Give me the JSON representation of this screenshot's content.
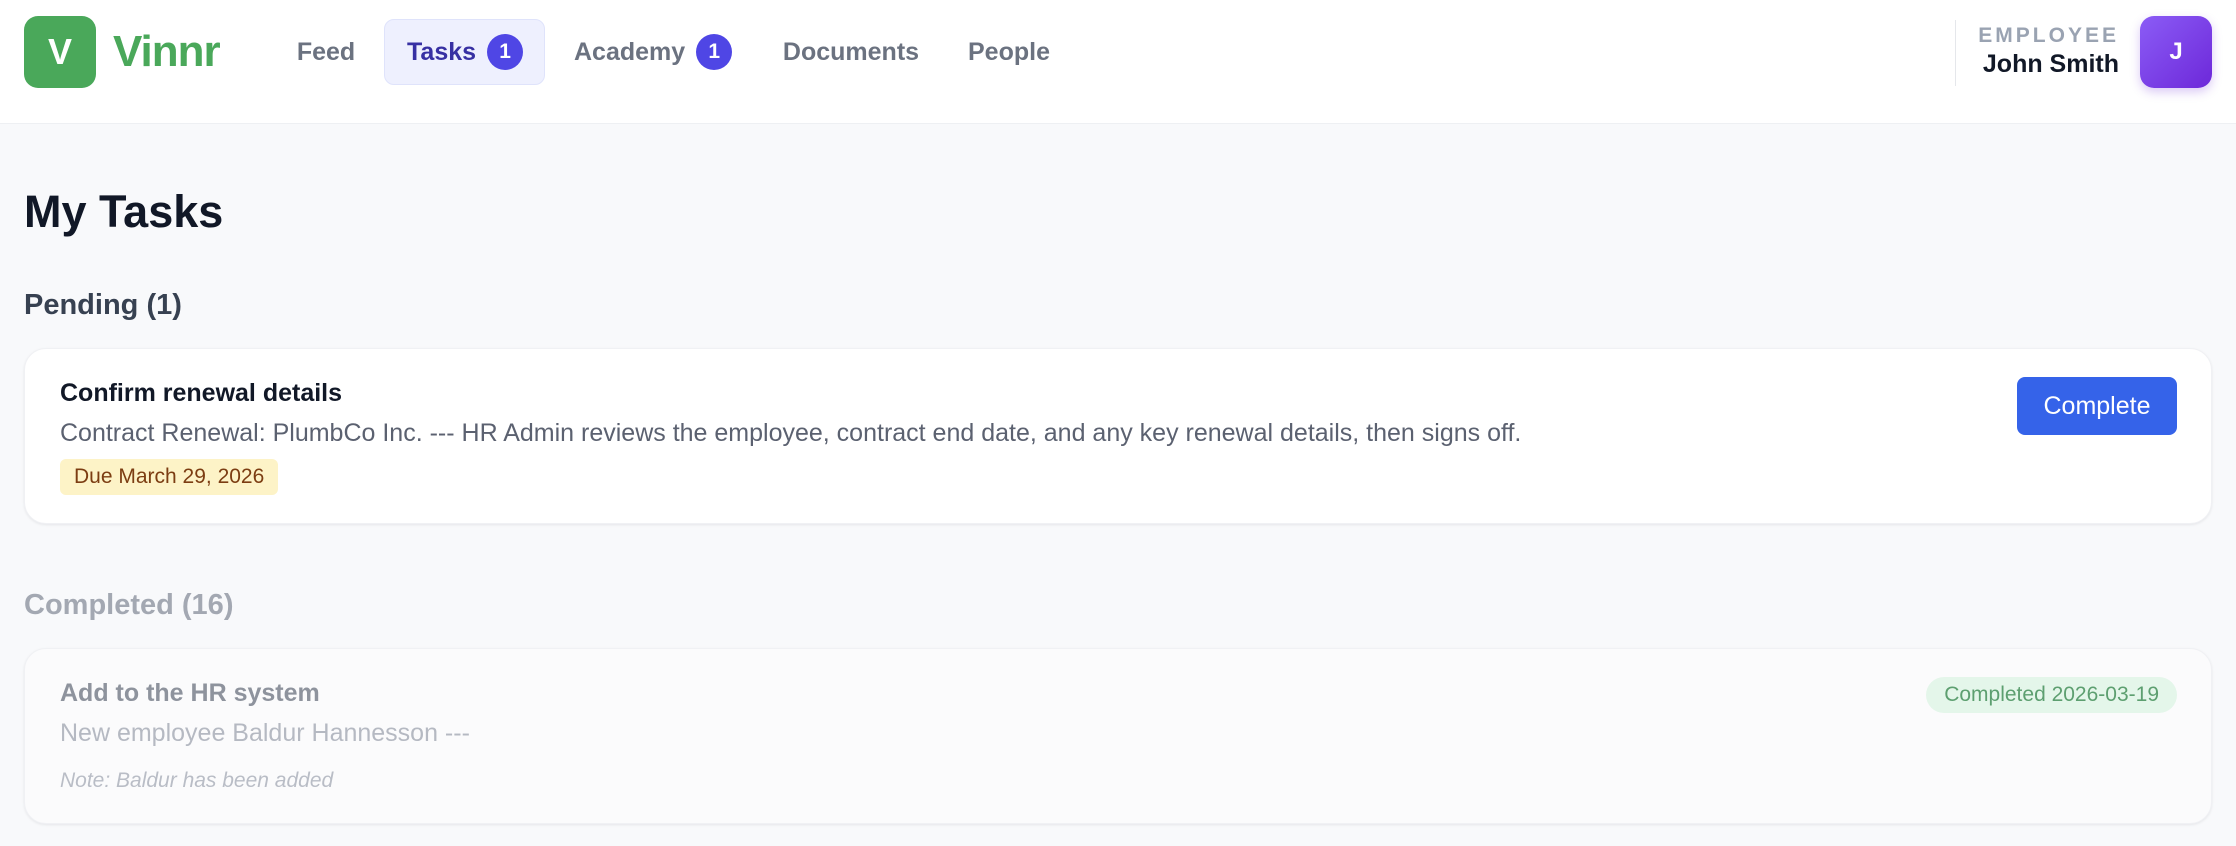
{
  "brand": {
    "logo_letter": "V",
    "name": "Vinnr",
    "color": "#4aa85a"
  },
  "nav": {
    "items": [
      {
        "label": "Feed"
      },
      {
        "label": "Tasks",
        "badge": "1",
        "active": true
      },
      {
        "label": "Academy",
        "badge": "1"
      },
      {
        "label": "Documents"
      },
      {
        "label": "People"
      }
    ],
    "badge_color": "#4f46e5"
  },
  "user": {
    "role": "EMPLOYEE",
    "name": "John Smith",
    "avatar_letter": "J"
  },
  "page": {
    "title": "My Tasks"
  },
  "pending": {
    "heading": "Pending (1)",
    "tasks": [
      {
        "title": "Confirm renewal details",
        "description": "Contract Renewal: PlumbCo Inc. --- HR Admin reviews the employee, contract end date, and any key renewal details, then signs off.",
        "due": "Due March 29, 2026",
        "action_label": "Complete"
      }
    ]
  },
  "completed": {
    "heading": "Completed (16)",
    "tasks": [
      {
        "title": "Add to the HR system",
        "description": "New employee Baldur Hannesson ---",
        "note": "Note: Baldur has been added",
        "status": "Completed 2026-03-19"
      }
    ]
  },
  "colors": {
    "primary_button": "#3563e9",
    "due_badge_bg": "#fdf3c7",
    "completed_badge_bg": "#e4f6ea"
  }
}
